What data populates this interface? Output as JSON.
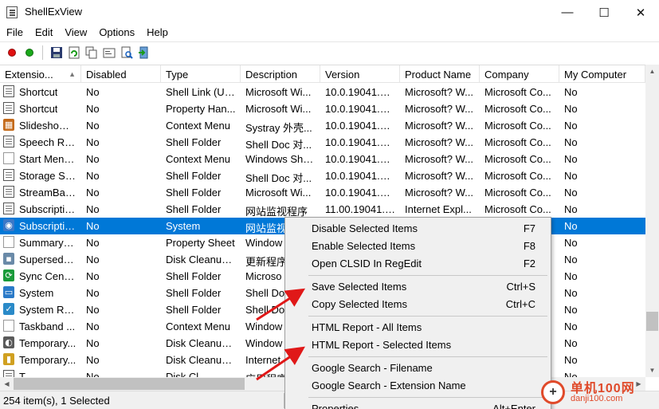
{
  "window": {
    "title": "ShellExView",
    "controls": {
      "minimize": "—",
      "maximize": "☐",
      "close": "✕"
    }
  },
  "menu": [
    "File",
    "Edit",
    "View",
    "Options",
    "Help"
  ],
  "toolbar": {
    "buttons": [
      {
        "icon": "red-circle-icon",
        "color": "#e01010"
      },
      {
        "icon": "green-circle-icon",
        "color": "#1aa81a"
      },
      {
        "icon": "save-icon"
      },
      {
        "icon": "refresh-icon"
      },
      {
        "icon": "copy-icon"
      },
      {
        "icon": "properties-icon"
      },
      {
        "icon": "find-icon"
      },
      {
        "icon": "exit-icon"
      }
    ]
  },
  "columns": [
    "Extensio...",
    "Disabled",
    "Type",
    "Description",
    "Version",
    "Product Name",
    "Company",
    "My Computer"
  ],
  "rows": [
    {
      "icon": "doc",
      "cells": [
        "Shortcut",
        "No",
        "Shell Link (Un...",
        "Microsoft Wi...",
        "10.0.19041.45...",
        "Microsoft? W...",
        "Microsoft Co...",
        "No"
      ]
    },
    {
      "icon": "doc",
      "cells": [
        "Shortcut",
        "No",
        "Property Han...",
        "Microsoft Wi...",
        "10.0.19041.45...",
        "Microsoft? W...",
        "Microsoft Co...",
        "No"
      ]
    },
    {
      "icon": "slideshow",
      "cells": [
        "SlideshowC...",
        "No",
        "Context Menu",
        "Systray 外壳...",
        "10.0.19041.45...",
        "Microsoft? W...",
        "Microsoft Co...",
        "No"
      ]
    },
    {
      "icon": "doc",
      "cells": [
        "Speech Rec...",
        "No",
        "Shell Folder",
        "Shell Doc 对...",
        "10.0.19041.45...",
        "Microsoft? W...",
        "Microsoft Co...",
        "No"
      ]
    },
    {
      "icon": "blank",
      "cells": [
        "Start Menu...",
        "No",
        "Context Menu",
        "Windows She...",
        "10.0.19041.96...",
        "Microsoft? W...",
        "Microsoft Co...",
        "No"
      ]
    },
    {
      "icon": "doc",
      "cells": [
        "Storage Sp...",
        "No",
        "Shell Folder",
        "Shell Doc 对...",
        "10.0.19041.45...",
        "Microsoft? W...",
        "Microsoft Co...",
        "No"
      ]
    },
    {
      "icon": "doc",
      "cells": [
        "StreamBac...",
        "No",
        "Shell Folder",
        "Microsoft Wi...",
        "10.0.19041.45...",
        "Microsoft? W...",
        "Microsoft Co...",
        "No"
      ]
    },
    {
      "icon": "doc",
      "cells": [
        "Subscriptio...",
        "No",
        "Shell Folder",
        "网站监视程序",
        "11.00.19041.4...",
        "Internet Expl...",
        "Microsoft Co...",
        "No"
      ]
    },
    {
      "icon": "subscription",
      "selected": true,
      "cells": [
        "Subscriptio...",
        "No",
        "System",
        "网站监视",
        "",
        "",
        "",
        "No"
      ]
    },
    {
      "icon": "blank",
      "cells": [
        "Summary P...",
        "No",
        "Property Sheet",
        "Window",
        "",
        "",
        "",
        "No"
      ]
    },
    {
      "icon": "disk",
      "cells": [
        "Supersede...",
        "No",
        "Disk Cleanup...",
        "更新程序",
        "",
        "",
        "",
        "No"
      ]
    },
    {
      "icon": "sync",
      "cells": [
        "Sync Cente...",
        "No",
        "Shell Folder",
        "Microso",
        "",
        "",
        "",
        "No"
      ]
    },
    {
      "icon": "system",
      "cells": [
        "System",
        "No",
        "Shell Folder",
        "Shell Do",
        "",
        "",
        "",
        "No"
      ]
    },
    {
      "icon": "restore",
      "cells": [
        "System Rec...",
        "No",
        "Shell Folder",
        "Shell Do",
        "",
        "",
        "",
        "No"
      ]
    },
    {
      "icon": "blank",
      "cells": [
        "Taskband ...",
        "No",
        "Context Menu",
        "Window",
        "",
        "",
        "",
        "No"
      ]
    },
    {
      "icon": "temp",
      "cells": [
        "Temporary...",
        "No",
        "Disk Cleanup...",
        "Window",
        "",
        "",
        "",
        "No"
      ]
    },
    {
      "icon": "lock",
      "cells": [
        "Temporary...",
        "No",
        "Disk Cleanup...",
        "Internet",
        "",
        "",
        "",
        "No"
      ]
    },
    {
      "icon": "doc",
      "cells": [
        "T...",
        "No",
        "Disk Cl...",
        "应用程序",
        "",
        "",
        "",
        "No"
      ]
    }
  ],
  "context_menu": {
    "items": [
      {
        "label": "Disable Selected Items",
        "shortcut": "F7"
      },
      {
        "label": "Enable Selected Items",
        "shortcut": "F8"
      },
      {
        "label": "Open CLSID In RegEdit",
        "shortcut": "F2"
      },
      {
        "separator": true
      },
      {
        "label": "Save Selected Items",
        "shortcut": "Ctrl+S"
      },
      {
        "label": "Copy Selected Items",
        "shortcut": "Ctrl+C"
      },
      {
        "separator": true
      },
      {
        "label": "HTML Report - All Items",
        "shortcut": ""
      },
      {
        "label": "HTML Report - Selected Items",
        "shortcut": ""
      },
      {
        "separator": true
      },
      {
        "label": "Google Search - Filename",
        "shortcut": ""
      },
      {
        "label": "Google Search - Extension Name",
        "shortcut": ""
      },
      {
        "separator": true
      },
      {
        "label": "Properties",
        "shortcut": "Alt+Enter"
      }
    ]
  },
  "status": {
    "text": "254 item(s), 1 Selected"
  },
  "watermark": {
    "big": "单机100网",
    "small": "danji100.com"
  },
  "colors": {
    "selection": "#0078d7",
    "arrow": "#e01818",
    "watermark": "#e04a2a"
  }
}
